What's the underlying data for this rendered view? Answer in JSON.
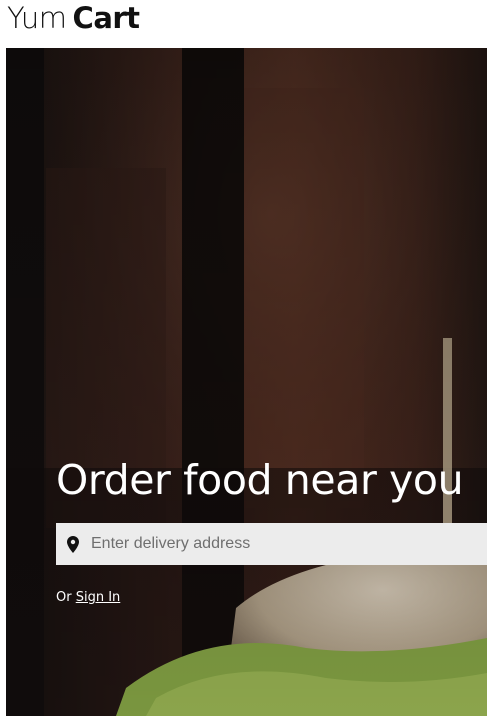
{
  "brand": {
    "name_light": "Yum",
    "name_bold": "Cart"
  },
  "hero": {
    "headline": "Order food near you",
    "address": {
      "placeholder": "Enter delivery address",
      "value": ""
    },
    "signin_prefix": "Or",
    "signin_link": "Sign In"
  },
  "colors": {
    "address_bar_bg": "#ececec",
    "hero_text": "#ffffff",
    "logo_text": "#111111"
  },
  "icons": {
    "address": "map-pin-icon"
  }
}
